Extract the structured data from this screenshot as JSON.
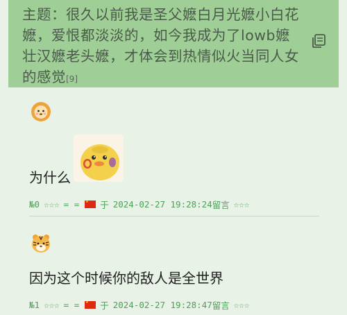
{
  "topic": {
    "text": "主题：很久以前我是圣父嬷白月光嬷小白花嬷，爱恨都淡淡的，如今我成为了lowb嬷壮汉嬷老头嬷，才体会到热情似火当同人女的感觉",
    "count": "[9]"
  },
  "posts": [
    {
      "avatar_icon": "lion-avatar-icon",
      "text": "为什么",
      "sticker_icon": "duck-sticker",
      "meta": {
        "number": "№0",
        "stars_left": "☆☆☆",
        "equals": "= =",
        "flag_icon": "china-flag-icon",
        "preposition": "于",
        "datetime": "2024-02-27 19:28:24",
        "reply_label": "留言",
        "stars_right": "☆☆☆"
      }
    },
    {
      "avatar_icon": "tiger-avatar-icon",
      "text": "因为这个时候你的敌人是全世界",
      "meta": {
        "number": "№1",
        "stars_left": "☆☆☆",
        "equals": "= =",
        "flag_icon": "china-flag-icon",
        "preposition": "于",
        "datetime": "2024-02-27 19:28:47",
        "reply_label": "留言",
        "stars_right": "☆☆☆"
      }
    }
  ],
  "colors": {
    "topic_bg": "#9fcf96",
    "page_bg": "#e8f2e6",
    "meta_green": "#4ca05a"
  }
}
